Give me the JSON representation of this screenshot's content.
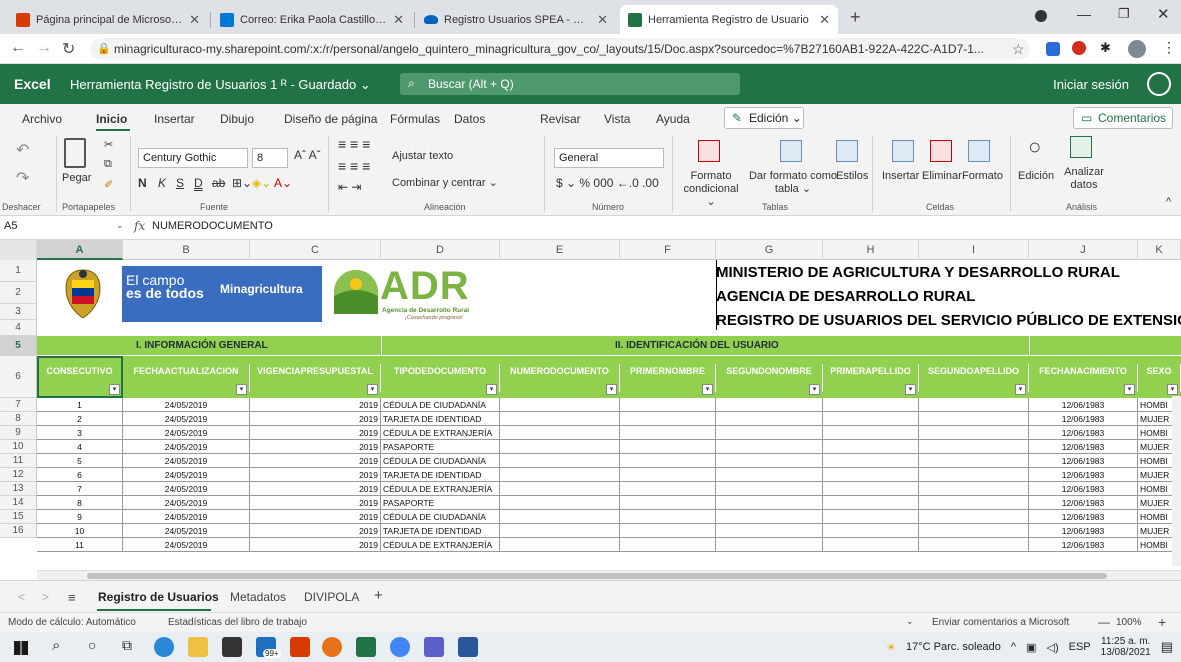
{
  "browser": {
    "tabs": [
      {
        "title": "Página principal de Microsoft Offi",
        "color": "#d83b01"
      },
      {
        "title": "Correo: Erika Paola Castillo Peralt",
        "color": "#0078d4"
      },
      {
        "title": "Registro Usuarios SPEA - OneDriv",
        "color": "#0364b8"
      },
      {
        "title": "Herramienta Registro de Usuario",
        "color": "#217346"
      }
    ],
    "new_tab": "+",
    "url": "minagriculturaco-my.sharepoint.com/:x:/r/personal/angelo_quintero_minagricultura_gov_co/_layouts/15/Doc.aspx?sourcedoc=%7B27160AB1-922A-422C-A1D7-1..."
  },
  "excel": {
    "brand": "Excel",
    "doc_title": "Herramienta Registro de Usuarios 1 ᴿ - Guardado ⌄",
    "search_placeholder": "Buscar (Alt + Q)",
    "signin": "Iniciar sesión"
  },
  "menu": {
    "items": [
      "Archivo",
      "Inicio",
      "Insertar",
      "Dibujo",
      "Diseño de página",
      "Fórmulas",
      "Datos",
      "Revisar",
      "Vista",
      "Ayuda"
    ],
    "edicion": "Edición ⌄",
    "comentarios": "Comentarios"
  },
  "ribbon": {
    "undo_group": "Deshacer",
    "paste": "Pegar",
    "clipboard_group": "Portapapeles",
    "font": "Century Gothic",
    "font_size": "8",
    "font_group": "Fuente",
    "wrap": "Ajustar texto",
    "merge": "Combinar y centrar ⌄",
    "align_group": "Alineación",
    "number_format": "General",
    "number_group": "Número",
    "cond_format": "Formato condicional ⌄",
    "table_format": "Dar formato como tabla ⌄",
    "styles": "Estilos",
    "tables_group": "Tablas",
    "insert": "Insertar",
    "delete": "Eliminar",
    "format": "Formato",
    "cells_group": "Celdas",
    "editing": "Edición",
    "analyze": "Analizar datos",
    "analysis_group": "Análisis"
  },
  "formula": {
    "cell": "A5",
    "value": "NUMERODOCUMENTO"
  },
  "columns": [
    "A",
    "B",
    "C",
    "D",
    "E",
    "F",
    "G",
    "H",
    "I",
    "J",
    "K"
  ],
  "sheet_header": {
    "logo_text1": "El campo",
    "logo_text2": "es de todos",
    "logo_text3": "Minagricultura",
    "adr": "ADR",
    "adr_sub": "Agencia de Desarrollo Rural",
    "adr_sub2": "¡Cosechando progreso!",
    "line1": "MINISTERIO DE AGRICULTURA Y DESARROLLO RURAL",
    "line2": "AGENCIA DE DESARROLLO RURAL",
    "line3": "REGISTRO DE USUARIOS DEL SERVICIO PÚBLICO DE EXTENSIÓ",
    "section1": "I. INFORMACIÓN GENERAL",
    "section2": "II. IDENTIFICACIÓN DEL USUARIO"
  },
  "table_headers": [
    "CONSECUTIVO",
    "FECHAACTUALIZACION",
    "VIGENCIAPRESUPUESTAL",
    "TIPODEDOCUMENTO",
    "NUMERODOCUMENTO",
    "PRIMERNOMBRE",
    "SEGUNDONOMBRE",
    "PRIMERAPELLIDO",
    "SEGUNDOAPELLIDO",
    "FECHANACIMIENTO",
    "SEXO"
  ],
  "row_numbers": [
    "1",
    "2",
    "3",
    "4",
    "5",
    "6",
    "7",
    "8",
    "9",
    "10",
    "11",
    "12",
    "13",
    "14",
    "15",
    "16"
  ],
  "rows": [
    [
      "1",
      "24/05/2019",
      "2019",
      "CÉDULA DE CIUDADANÍA",
      "12/06/1983",
      "HOMBI"
    ],
    [
      "2",
      "24/05/2019",
      "2019",
      "TARJETA DE IDENTIDAD",
      "12/06/1983",
      "MUJER"
    ],
    [
      "3",
      "24/05/2019",
      "2019",
      "CÉDULA DE EXTRANJERÍA",
      "12/06/1983",
      "HOMBI"
    ],
    [
      "4",
      "24/05/2019",
      "2019",
      "PASAPORTE",
      "12/06/1983",
      "MUJER"
    ],
    [
      "5",
      "24/05/2019",
      "2019",
      "CÉDULA DE CIUDADANÍA",
      "12/06/1983",
      "HOMBI"
    ],
    [
      "6",
      "24/05/2019",
      "2019",
      "TARJETA DE IDENTIDAD",
      "12/06/1983",
      "MUJER"
    ],
    [
      "7",
      "24/05/2019",
      "2019",
      "CÉDULA DE EXTRANJERÍA",
      "12/06/1983",
      "HOMBI"
    ],
    [
      "8",
      "24/05/2019",
      "2019",
      "PASAPORTE",
      "12/06/1983",
      "MUJER"
    ],
    [
      "9",
      "24/05/2019",
      "2019",
      "CÉDULA DE CIUDADANÍA",
      "12/06/1983",
      "HOMBI"
    ],
    [
      "10",
      "24/05/2019",
      "2019",
      "TARJETA DE IDENTIDAD",
      "12/06/1983",
      "MUJER"
    ],
    [
      "11",
      "24/05/2019",
      "2019",
      "CÉDULA DE EXTRANJERÍA",
      "12/06/1983",
      "HOMBI"
    ]
  ],
  "sheets": [
    "Registro de Usuarios",
    "Metadatos",
    "DIVIPOLA"
  ],
  "status": {
    "calc": "Modo de cálculo: Automático",
    "stats": "Estadísticas del libro de trabajo",
    "feedback": "Enviar comentarios a Microsoft",
    "zoom": "100%"
  },
  "taskbar": {
    "weather": "17°C  Parc. soleado",
    "lang": "ESP",
    "time": "11:25 a. m.",
    "date": "13/08/2021",
    "badge": "99+"
  },
  "colors": {
    "excel_green": "#217346",
    "header_green": "#92d050"
  }
}
